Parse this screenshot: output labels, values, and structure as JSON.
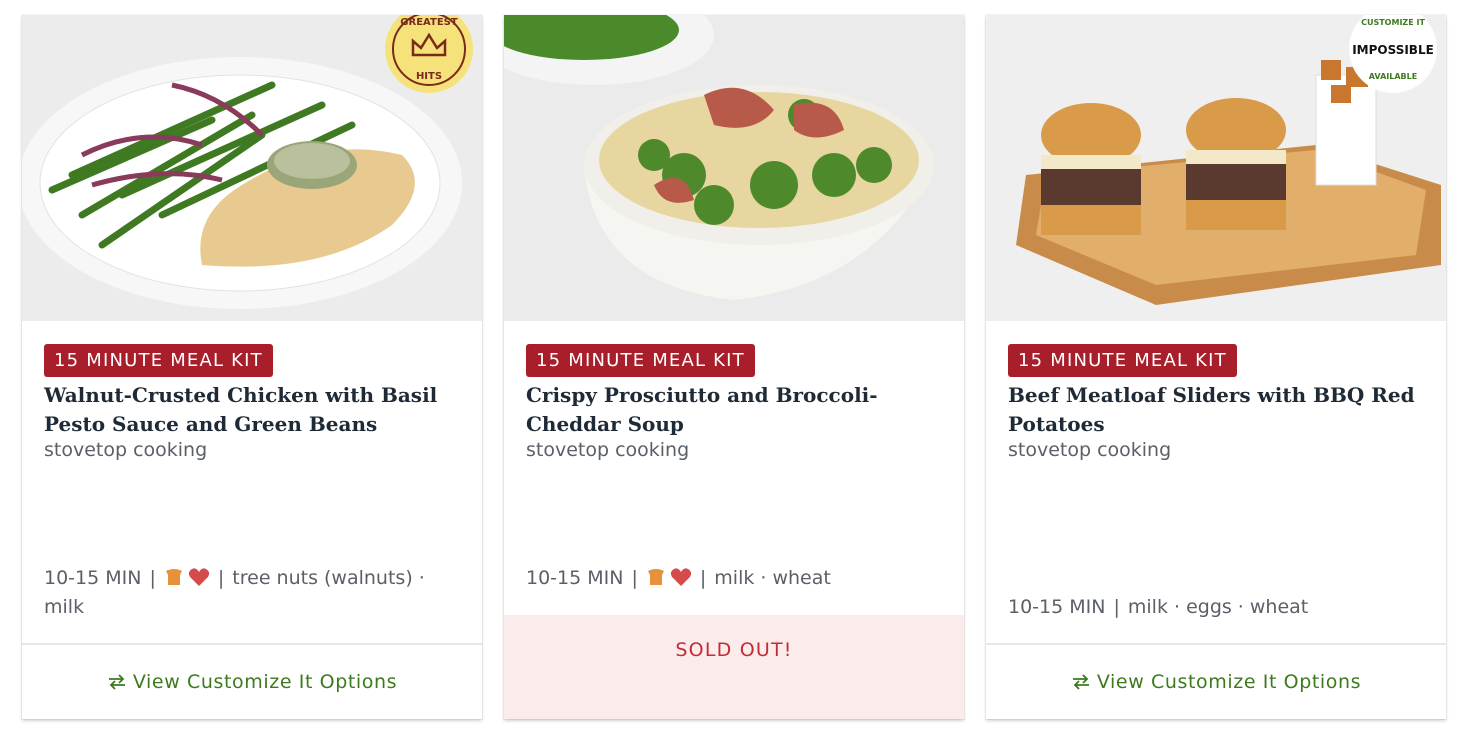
{
  "cards": [
    {
      "tag": "15 MINUTE MEAL KIT",
      "title": "Walnut-Crusted Chicken with Basil Pesto Sauce and Green Beans",
      "method": "stovetop cooking",
      "time": "10-15 MIN",
      "icons": [
        "kid-friendly-icon",
        "heart-icon"
      ],
      "allergens": "tree nuts (walnuts) · milk",
      "badge": {
        "text": "GREATEST HITS",
        "icon": "crown-icon"
      },
      "footer": {
        "type": "customize",
        "label": "View Customize It Options",
        "icon": "swap-arrows-icon"
      }
    },
    {
      "tag": "15 MINUTE MEAL KIT",
      "title": "Crispy Prosciutto and Broccoli-Cheddar Soup",
      "method": "stovetop cooking",
      "time": "10-15 MIN",
      "icons": [
        "kid-friendly-icon",
        "heart-icon"
      ],
      "allergens": "milk · wheat",
      "footer": {
        "type": "soldout",
        "label": "SOLD OUT!"
      }
    },
    {
      "tag": "15 MINUTE MEAL KIT",
      "title": "Beef Meatloaf Sliders with BBQ Red Potatoes",
      "method": "stovetop cooking",
      "time": "10-15 MIN",
      "icons": [],
      "allergens": "milk · eggs · wheat",
      "badge": {
        "text_top": "CUSTOMIZE IT",
        "brand": "IMPOSSIBLE",
        "text_bottom": "AVAILABLE"
      },
      "footer": {
        "type": "customize",
        "label": "View Customize It Options",
        "icon": "swap-arrows-icon"
      }
    }
  ],
  "colors": {
    "tag": "#a81e2a",
    "customize": "#3d7a1e",
    "soldout_bg": "#fbeceb",
    "soldout_text": "#c62a36"
  }
}
